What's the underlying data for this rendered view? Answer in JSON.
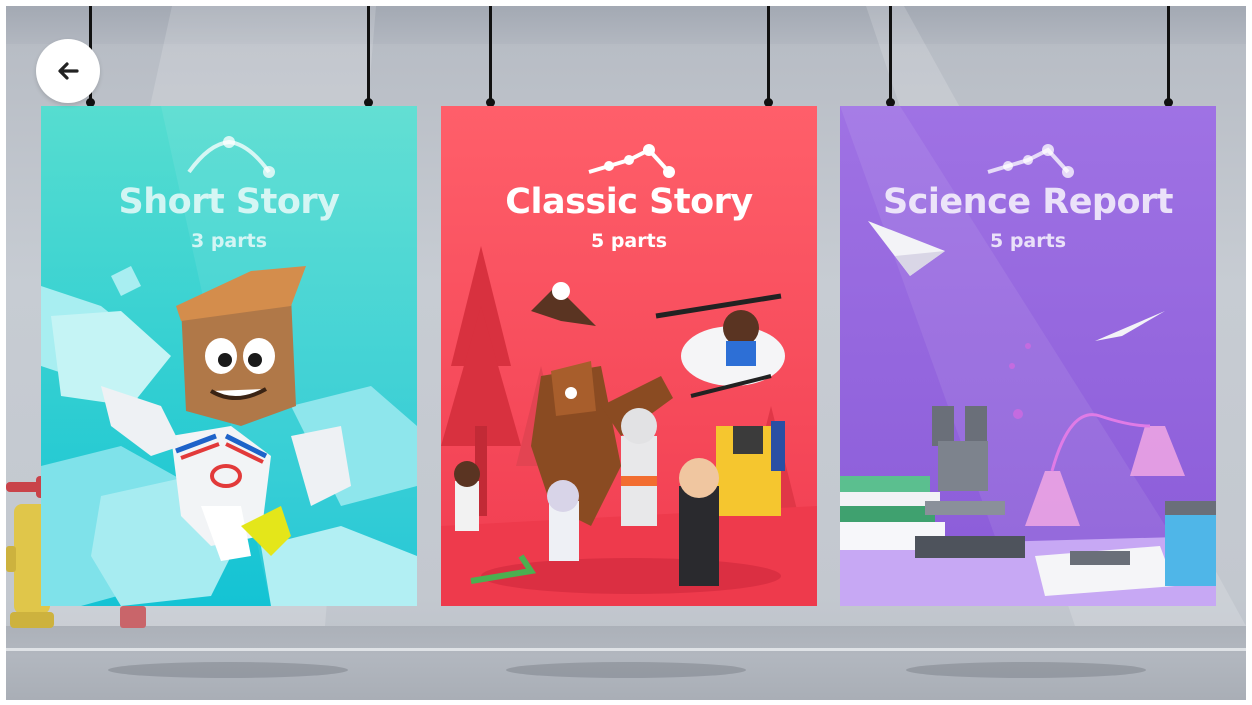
{
  "back_button": {
    "icon": "arrow-left-icon",
    "color": "#222222"
  },
  "cards": [
    {
      "title": "Short Story",
      "subtitle": "3 parts",
      "color": "#3ed6cc",
      "arc_icon": "story-arc-3-icon"
    },
    {
      "title": "Classic Story",
      "subtitle": "5 parts",
      "color": "#f7505b",
      "arc_icon": "story-arc-5-icon"
    },
    {
      "title": "Science Report",
      "subtitle": "5 parts",
      "color": "#9b6fe0",
      "arc_icon": "story-arc-5-icon"
    }
  ]
}
